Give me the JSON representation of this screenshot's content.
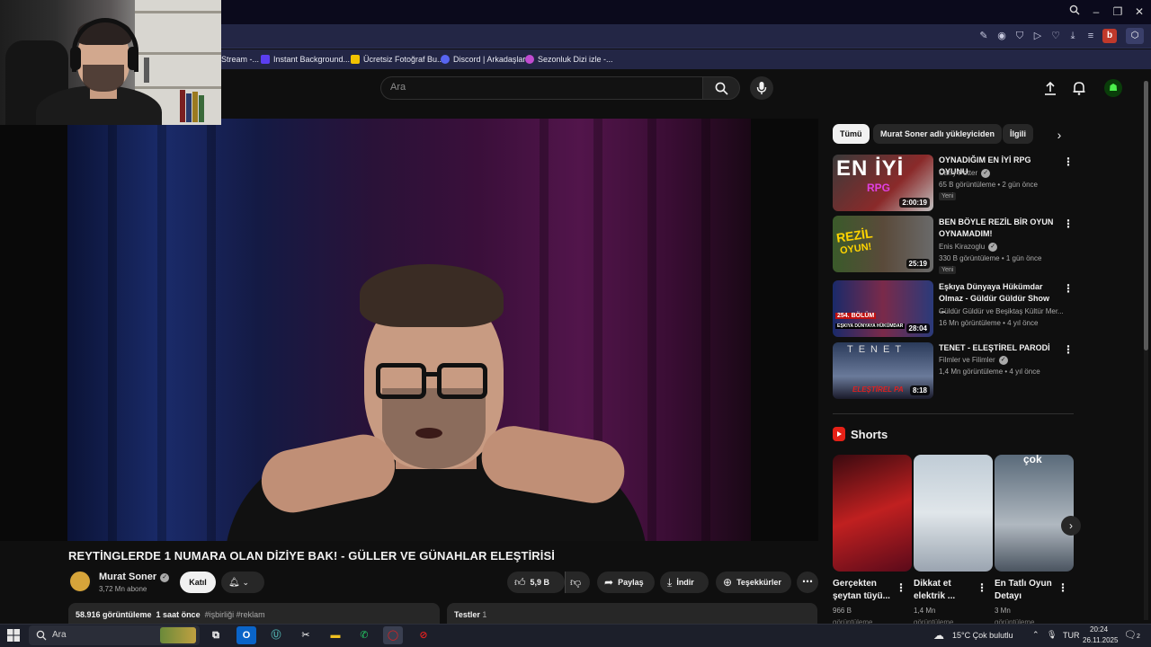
{
  "search": {
    "placeholder": "Ara"
  },
  "bookmarks": [
    {
      "label": "Stream -...",
      "color": "#888888"
    },
    {
      "label": "Instant Background...",
      "color": "#5b3ef0"
    },
    {
      "label": "Ücretsiz Fotoğraf Bu...",
      "color": "#f2c200"
    },
    {
      "label": "Discord | Arkadaşlar",
      "color": "#5865f2"
    },
    {
      "label": "Sezonluk Dizi izle -...",
      "color": "#c04bd0"
    }
  ],
  "browser": {
    "profile_letter": "b"
  },
  "video": {
    "title": "REYTİNGLERDE 1 NUMARA OLAN DİZİYE BAK! - GÜLLER VE GÜNAHLAR ELEŞTİRİSİ",
    "channel": "Murat Soner",
    "subscribers": "3,72 Mn abone",
    "join_label": "Katıl",
    "likes": "5,9 B",
    "share_label": "Paylaş",
    "download_label": "İndir",
    "thanks_label": "Teşekkürler",
    "views": "58.916 görüntüleme",
    "time": "1 saat önce",
    "tags": "#işbirliği #reklam",
    "tests_label": "Testler",
    "tests_count": "1"
  },
  "chips": [
    "Tümü",
    "Murat Soner adlı yükleyiciden",
    "İlgili"
  ],
  "recommended": [
    {
      "title": "OYNADIĞIM EN İYİ RPG OYUNU",
      "channel": "Carry Potter",
      "meta": "65 B görüntüleme • 2 gün önce",
      "badge": "Yeni",
      "duration": "2:00:19",
      "thumb_text": "EN İYİ",
      "thumb_sub": "RPG"
    },
    {
      "title": "BEN BÖYLE REZİL BİR OYUN OYNAMADIM!",
      "channel": "Enis Kirazoglu",
      "meta": "330 B görüntüleme • 1 gün önce",
      "badge": "Yeni",
      "duration": "25:19",
      "thumb_text": "REZİL",
      "thumb_sub": "OYUN!"
    },
    {
      "title": "Eşkıya Dünyaya Hükümdar Olmaz - Güldür Güldür Show ...",
      "channel": "Güldür Güldür ve Beşiktaş Kültür Mer...",
      "meta": "16 Mn görüntüleme • 4 yıl önce",
      "badge": "",
      "duration": "28:04",
      "thumb_text": "254. BÖLÜM",
      "thumb_sub": "EŞKIYA DÜNYAYA HÜKÜMDAR"
    },
    {
      "title": "TENET - ELEŞTİREL PARODİ",
      "channel": "Filmler ve Filimler",
      "meta": "1,4 Mn görüntüleme • 4 yıl önce",
      "badge": "",
      "duration": "8:18",
      "thumb_text": "TENET",
      "thumb_sub": "ELEŞTİREL PA"
    }
  ],
  "shorts": {
    "heading": "Shorts",
    "items": [
      {
        "title": "Gerçekten şeytan tüyü...",
        "views": "966 B",
        "views_label": "görüntüleme"
      },
      {
        "title": "Dikkat et elektrik ...",
        "views": "1,4 Mn",
        "views_label": "görüntüleme"
      },
      {
        "title": "En Tatlı Oyun Detayı",
        "views": "3 Mn",
        "views_label": "görüntüleme",
        "thumb_text": "çok"
      }
    ]
  },
  "taskbar": {
    "search_placeholder": "Ara",
    "weather": "15°C  Çok bulutlu",
    "lang": "TUR",
    "time": "20:24",
    "date": "26.11.2025",
    "notif_count": "2"
  }
}
